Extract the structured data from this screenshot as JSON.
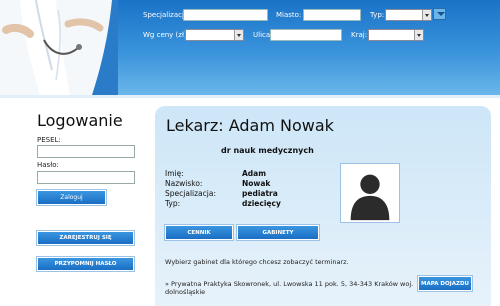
{
  "header": {
    "search": {
      "specialization_label": "Specjalizacja:",
      "city_label": "Miasto:",
      "type_label": "Typ:",
      "price_label": "Wg ceny (zł):",
      "street_label": "Ulica:",
      "country_label": "Kraj:"
    }
  },
  "login": {
    "title": "Logowanie",
    "pesel_label": "PESEL:",
    "password_label": "Hasło:",
    "login_button": "Zaloguj",
    "register_button": "ZAREJESTRUJ SIĘ",
    "remind_password_button": "PRZYPOMNIJ HASŁO"
  },
  "doctor": {
    "title": "Lekarz: Adam Nowak",
    "degree": "dr nauk medycznych",
    "fields": [
      {
        "label": "Imię:",
        "value": "Adam"
      },
      {
        "label": "Nazwisko:",
        "value": "Nowak"
      },
      {
        "label": "Specjalizacja:",
        "value": "pediatra"
      },
      {
        "label": "Typ:",
        "value": "dziecięcy"
      }
    ],
    "pricelist_button": "CENNIK",
    "offices_button": "GABINETY",
    "hint": "Wybierz gabinet dla którego chcesz zobaczyć terminarz.",
    "cabinet": "» Prywatna Praktyka Skowronek, ul. Lwowska 11 pok. 5, 34-343 Kraków woj. dolnośląskie",
    "map_button": "MAPA DOJAZDU"
  },
  "colors": {
    "banner": "#1a73c7",
    "button": "#1a6ec4",
    "panel": "#cde6f8"
  }
}
